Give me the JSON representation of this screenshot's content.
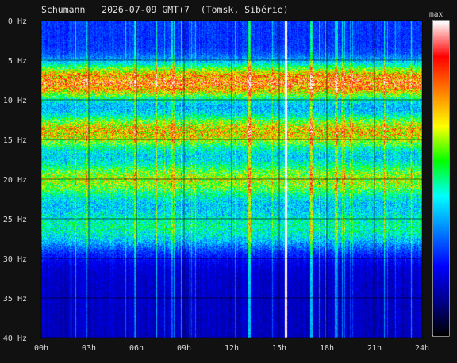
{
  "chart_data": {
    "type": "heatmap",
    "title": "Schumann — 2026-07-09 GMT+7  (Tomsk, Sibérie)",
    "x_ticks": [
      "00h",
      "03h",
      "06h",
      "09h",
      "12h",
      "15h",
      "18h",
      "21h",
      "24h"
    ],
    "y_ticks": [
      "0 Hz",
      "5 Hz",
      "10 Hz",
      "15 Hz",
      "20 Hz",
      "25 Hz",
      "30 Hz",
      "35 Hz",
      "40 Hz"
    ],
    "x_range_hours": [
      0,
      24
    ],
    "y_range_hz": [
      0,
      40
    ],
    "y_inverted": true,
    "grid": true,
    "colorbar": {
      "label": "max",
      "colors": [
        "#000000",
        "#00008b",
        "#0000ff",
        "#0080ff",
        "#00ffff",
        "#00ff00",
        "#ffff00",
        "#ff8000",
        "#ff0000",
        "#ffffff"
      ]
    },
    "bands_hz": [
      {
        "center": 7.8,
        "width": 2.2,
        "intensity": 0.62
      },
      {
        "center": 14.0,
        "width": 2.4,
        "intensity": 0.52
      },
      {
        "center": 20.0,
        "width": 2.6,
        "intensity": 0.44
      },
      {
        "center": 26.0,
        "width": 3.0,
        "intensity": 0.3
      }
    ],
    "vertical_streaks_hours": [
      {
        "t": 15.4,
        "intensity": 1.0
      },
      {
        "t": 13.1,
        "intensity": 0.55
      },
      {
        "t": 17.0,
        "intensity": 0.5
      },
      {
        "t": 5.9,
        "intensity": 0.35
      },
      {
        "t": 8.2,
        "intensity": 0.3
      }
    ]
  }
}
